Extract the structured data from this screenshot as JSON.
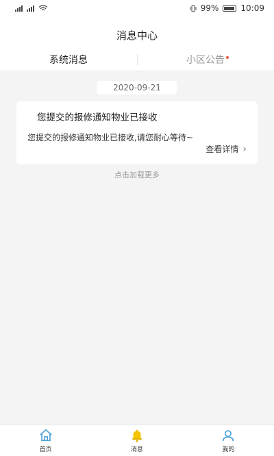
{
  "status": {
    "battery_percent": "99%",
    "time": "10:09"
  },
  "header": {
    "title": "消息中心"
  },
  "tabs": [
    {
      "label": "系统消息",
      "active": true
    },
    {
      "label": "小区公告",
      "active": false,
      "has_dot": true
    }
  ],
  "messages": [
    {
      "date": "2020-09-21",
      "title": "您提交的报修通知物业已接收",
      "body": "您提交的报修通知物业已接收,请您耐心等待~",
      "link_label": "查看详情"
    }
  ],
  "load_more": "点击加载更多",
  "nav": [
    {
      "label": "首页",
      "icon": "home-icon"
    },
    {
      "label": "消息",
      "icon": "bell-icon"
    },
    {
      "label": "我的",
      "icon": "person-icon"
    }
  ],
  "colors": {
    "accent_yellow": "#f5c400",
    "accent_blue": "#4aa0d8",
    "dot_red": "#f05a3c"
  }
}
